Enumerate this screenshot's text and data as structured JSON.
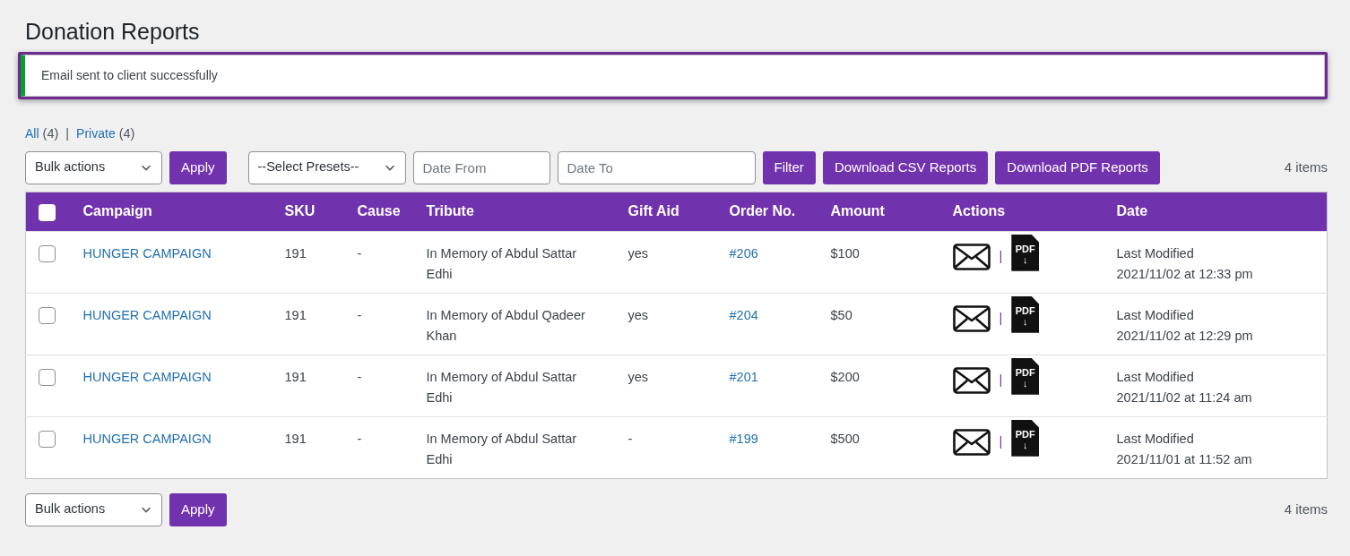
{
  "page_title": "Donation Reports",
  "notice": {
    "message": "Email sent to client successfully",
    "highlighted": true
  },
  "views": [
    {
      "label": "All",
      "count": "(4)",
      "selected": false
    },
    {
      "label": "Private",
      "count": "(4)",
      "selected": false
    }
  ],
  "view_separator": "|",
  "toolbar": {
    "bulk_actions": "Bulk actions",
    "apply": "Apply",
    "presets": "--Select Presets--",
    "date_from_placeholder": "Date From",
    "date_to_placeholder": "Date To",
    "filter": "Filter",
    "download_csv": "Download CSV Reports",
    "download_pdf": "Download PDF Reports",
    "items_count": "4 items"
  },
  "table": {
    "columns": [
      "Campaign",
      "SKU",
      "Cause",
      "Tribute",
      "Gift Aid",
      "Order No.",
      "Amount",
      "Actions",
      "Date"
    ],
    "select_all_checked": false,
    "rows": [
      {
        "checked": false,
        "campaign": "HUNGER CAMPAIGN",
        "sku": "191",
        "cause": "-",
        "tribute": "In Memory of Abdul Sattar Edhi",
        "gift_aid": "yes",
        "order": "#206",
        "amount": "$100",
        "action_separator": "|",
        "pdf_label": "PDF",
        "pdf_arrow": "↓",
        "date_label": "Last Modified",
        "date": "2021/11/02 at 12:33 pm"
      },
      {
        "checked": false,
        "campaign": "HUNGER CAMPAIGN",
        "sku": "191",
        "cause": "-",
        "tribute": "In Memory of Abdul Qadeer Khan",
        "gift_aid": "yes",
        "order": "#204",
        "amount": "$50",
        "action_separator": "|",
        "pdf_label": "PDF",
        "pdf_arrow": "↓",
        "date_label": "Last Modified",
        "date": "2021/11/02 at 12:29 pm"
      },
      {
        "checked": false,
        "campaign": "HUNGER CAMPAIGN",
        "sku": "191",
        "cause": "-",
        "tribute": "In Memory of Abdul Sattar Edhi",
        "gift_aid": "yes",
        "order": "#201",
        "amount": "$200",
        "action_separator": "|",
        "pdf_label": "PDF",
        "pdf_arrow": "↓",
        "date_label": "Last Modified",
        "date": "2021/11/02 at 11:24 am"
      },
      {
        "checked": false,
        "campaign": "HUNGER CAMPAIGN",
        "sku": "191",
        "cause": "-",
        "tribute": "In Memory of Abdul Sattar Edhi",
        "gift_aid": "-",
        "order": "#199",
        "amount": "$500",
        "action_separator": "|",
        "pdf_label": "PDF",
        "pdf_arrow": "↓",
        "date_label": "Last Modified",
        "date": "2021/11/01 at 11:52 am"
      }
    ]
  },
  "bottom_toolbar": {
    "bulk_actions": "Bulk actions",
    "apply": "Apply",
    "items_count": "4 items"
  }
}
